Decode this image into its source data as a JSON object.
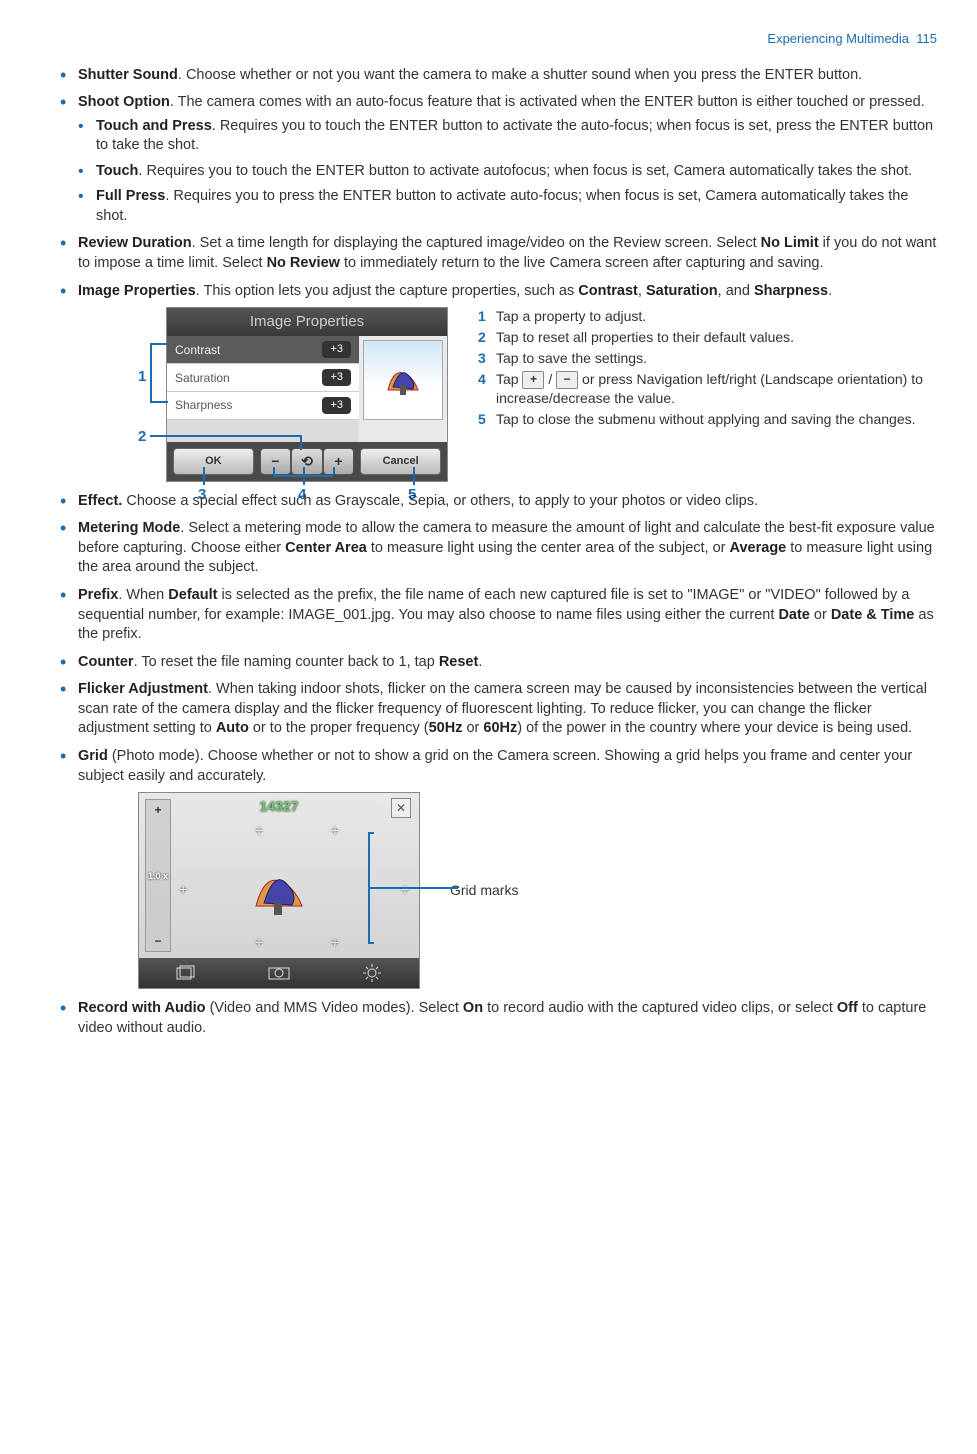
{
  "header": {
    "section": "Experiencing Multimedia",
    "page": "115"
  },
  "items": {
    "shutter": {
      "title": "Shutter Sound",
      "text": ". Choose whether or not you want the camera to make a shutter sound when you press the ENTER button."
    },
    "shoot": {
      "title": "Shoot Option",
      "text": ". The camera comes with an auto-focus feature that is activated when the ENTER button is either touched or pressed.",
      "sub": {
        "tp": {
          "title": "Touch and Press",
          "text": ". Requires you to touch the ENTER button to activate the auto-focus; when focus is set, press the ENTER button to take the shot."
        },
        "t": {
          "title": "Touch",
          "text": ". Requires you to touch the ENTER button to activate autofocus; when focus is set, Camera automatically takes the shot."
        },
        "fp": {
          "title": "Full Press",
          "text": ". Requires you to press the ENTER button to activate auto-focus; when focus is set, Camera automatically takes the shot."
        }
      }
    },
    "review": {
      "title": "Review Duration",
      "t1": ". Set a time length for displaying the captured image/video on the Review screen. Select ",
      "b1": "No Limit",
      "t2": " if you do not want to impose a time limit. Select ",
      "b2": "No Review",
      "t3": " to immediately return to the live Camera screen after capturing and saving."
    },
    "imgprops": {
      "title": "Image Properties",
      "t1": ". This option lets you adjust the capture properties, such as ",
      "b1": "Contrast",
      "s1": ", ",
      "b2": "Saturation",
      "s2": ", and ",
      "b3": "Sharpness",
      "s3": "."
    },
    "effect": {
      "title": "Effect.",
      "text": " Choose a special effect such as Grayscale, Sepia, or others, to apply to your photos or video clips."
    },
    "metering": {
      "title": "Metering Mode",
      "t1": ". Select a metering mode to allow the camera to measure the amount of light and calculate the best-fit exposure value before capturing. Choose either ",
      "b1": "Center Area",
      "t2": " to measure light using the center area of the subject, or ",
      "b2": "Average",
      "t3": " to measure light using the area around the subject."
    },
    "prefix": {
      "title": "Prefix",
      "t1": ". When ",
      "b1": "Default",
      "t2": " is selected as the prefix, the file name of each new captured file is set to \"IMAGE\" or \"VIDEO\" followed by a sequential number, for example: IMAGE_001.jpg. You may also choose to name files using either the current ",
      "b2": "Date",
      "t3": " or ",
      "b3": "Date & Time",
      "t4": " as the prefix."
    },
    "counter": {
      "title": "Counter",
      "t1": ". To reset the file naming counter back to 1, tap ",
      "b1": "Reset",
      "t2": "."
    },
    "flicker": {
      "title": "Flicker Adjustment",
      "t1": ". When taking indoor shots, flicker on the camera screen may be caused by inconsistencies between the vertical scan rate of the camera display and the flicker frequency of fluorescent lighting. To reduce flicker, you can change the flicker adjustment setting to ",
      "b1": "Auto",
      "t2": " or to the proper frequency (",
      "b2": "50Hz",
      "t3": " or ",
      "b3": "60Hz",
      "t4": ") of the power in the country where your device is being used."
    },
    "grid": {
      "title": "Grid",
      "text": " (Photo mode). Choose whether or not to show a grid on the Camera screen. Showing a grid helps you frame and center your subject easily and accurately."
    },
    "record": {
      "title": "Record with Audio",
      "t1": " (Video and MMS Video modes). Select ",
      "b1": "On",
      "t2": " to record audio with the captured video clips, or select ",
      "b3": "Off",
      "t3": " to capture video without audio."
    }
  },
  "ip_shot": {
    "title": "Image Properties",
    "rows": {
      "r1": "Contrast",
      "r2": "Saturation",
      "r3": "Sharpness",
      "badge": "+3"
    },
    "ok": "OK",
    "cancel": "Cancel",
    "callouts": {
      "n1": "1",
      "n2": "2",
      "n3": "3",
      "n4": "4",
      "n5": "5"
    },
    "legend": {
      "l1": "Tap a property to adjust.",
      "l2": "Tap to reset all properties to their default values.",
      "l3": "Tap to save the settings.",
      "l4a": "Tap ",
      "l4b": " / ",
      "l4c": " or press Navigation left/right (Landscape orientation) to increase/decrease the value.",
      "l5": "Tap to close the submenu without applying and saving the changes."
    }
  },
  "grid_shot": {
    "count": "14327",
    "zoom_label": "1.0 x",
    "label": "Grid marks"
  }
}
